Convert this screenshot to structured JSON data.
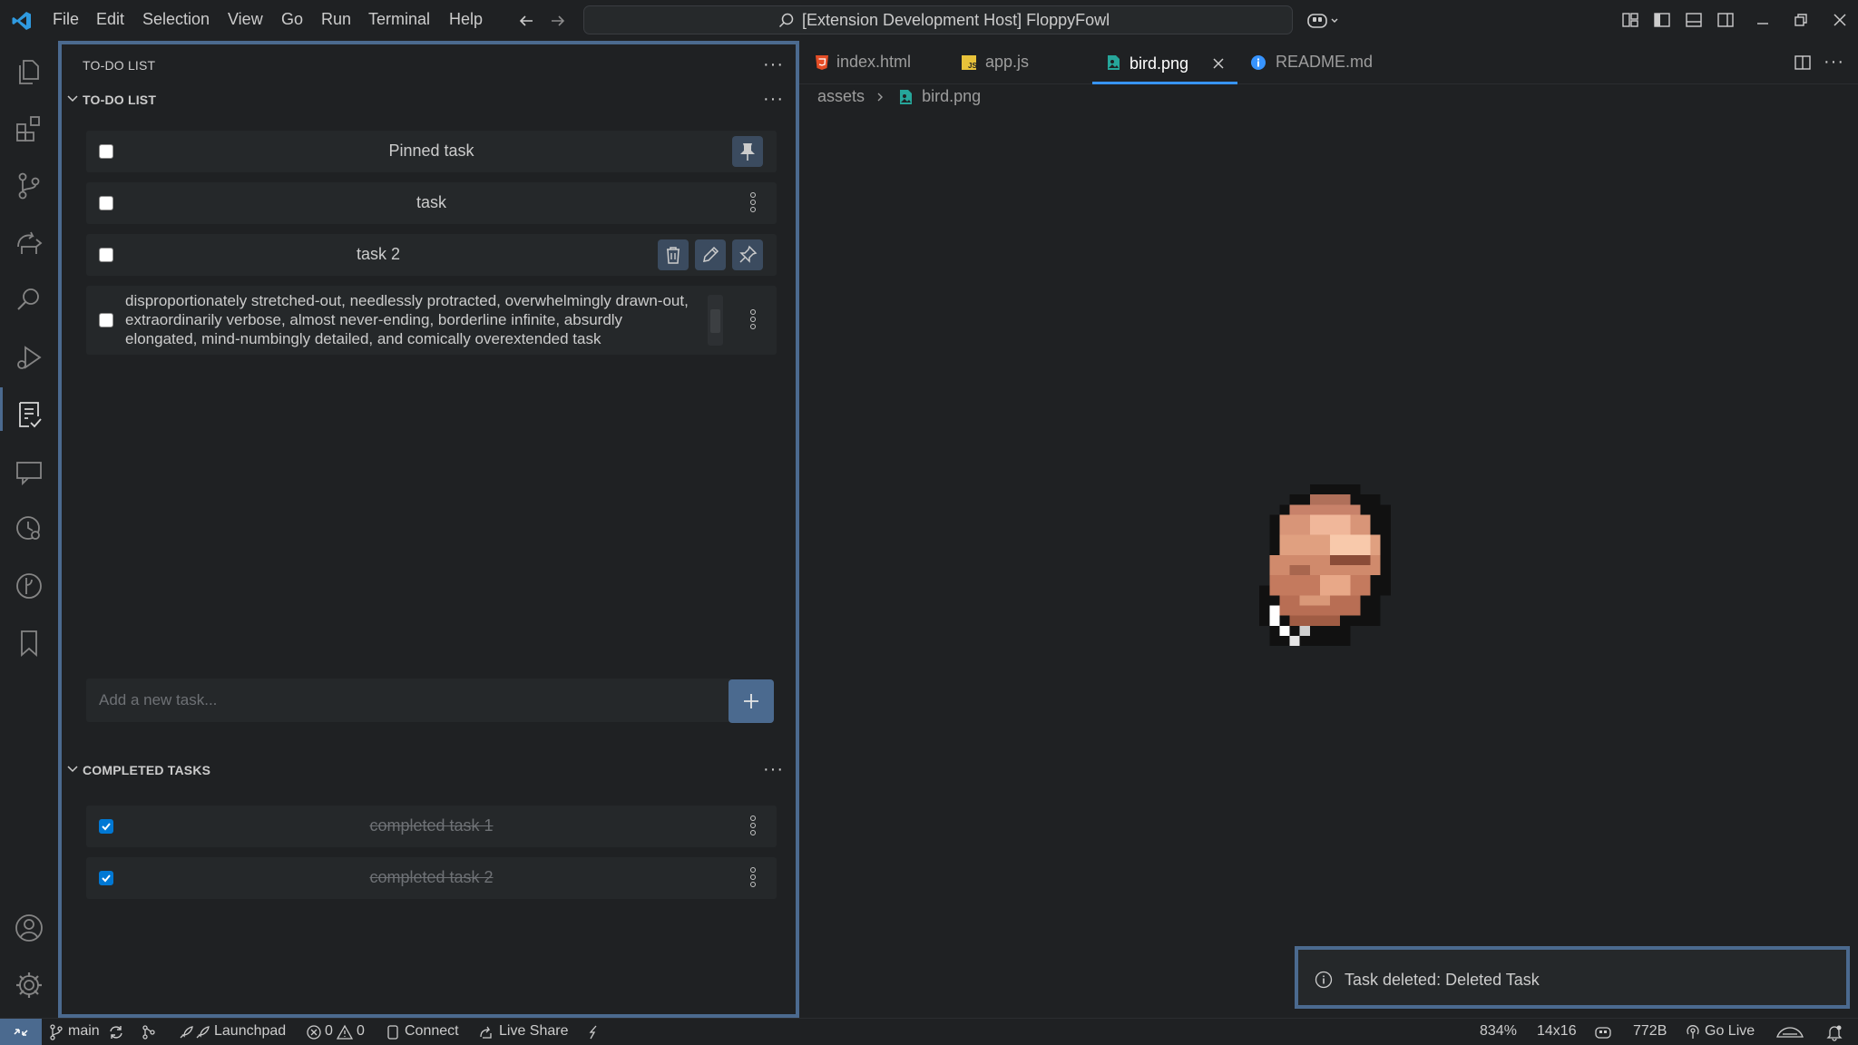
{
  "menu": [
    "File",
    "Edit",
    "Selection",
    "View",
    "Go",
    "Run",
    "Terminal",
    "Help"
  ],
  "command_center": "[Extension Development Host] FloppyFowl",
  "sidebar": {
    "view_title": "TO-DO LIST",
    "todo_section": "TO-DO LIST",
    "tasks": [
      {
        "label": "Pinned task"
      },
      {
        "label": "task"
      },
      {
        "label": "task 2"
      },
      {
        "label": "disproportionately stretched-out, needlessly protracted, overwhelmingly drawn-out, extraordinarily verbose, almost never-ending, borderline infinite, absurdly elongated, mind-numbingly detailed, and comically overextended task"
      }
    ],
    "add_placeholder": "Add a new task...",
    "completed_section": "COMPLETED TASKS",
    "completed": [
      {
        "label": "completed task 1"
      },
      {
        "label": "completed task 2"
      }
    ]
  },
  "tabs": [
    {
      "label": "index.html",
      "icon": "html-file-icon"
    },
    {
      "label": "app.js",
      "icon": "js-file-icon"
    },
    {
      "label": "bird.png",
      "icon": "image-file-icon"
    },
    {
      "label": "README.md",
      "icon": "info-icon"
    }
  ],
  "breadcrumb": {
    "folder": "assets",
    "file": "bird.png"
  },
  "toast": "Task deleted: Deleted Task",
  "status": {
    "branch": "main",
    "launchpad": "Launchpad",
    "errors": "0",
    "warnings": "0",
    "connect": "Connect",
    "live_share": "Live Share",
    "zoom": "834%",
    "dimensions": "14x16",
    "size": "772B",
    "go_live": "Go Live"
  },
  "colors": {
    "accent": "#4b6a8f",
    "checkbox": "#0078d4",
    "background": "#1f2123"
  }
}
